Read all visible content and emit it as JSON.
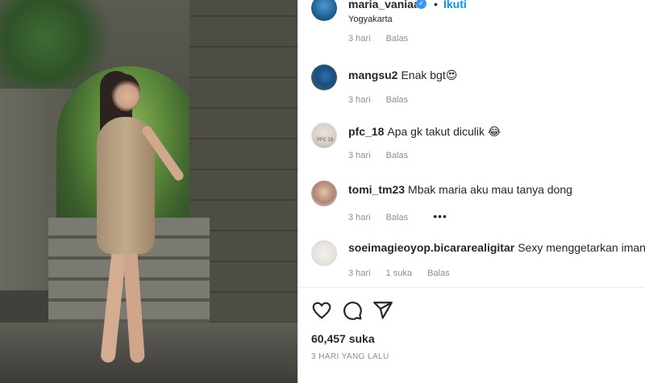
{
  "post": {
    "username": "maria_vaniaa",
    "separator": "•",
    "follow_label": "Ikuti",
    "location": "Yogyakarta",
    "verified_icon": "verified-badge-icon"
  },
  "comments": [
    {
      "username": "",
      "text": "",
      "time": "3 hari",
      "reply": "Balas",
      "likes": ""
    },
    {
      "username": "mangsu2",
      "text": "Enak bgt😍",
      "time": "3 hari",
      "reply": "Balas",
      "likes": ""
    },
    {
      "username": "pfc_18",
      "text": "Apa gk takut diculik 😂",
      "time": "3 hari",
      "reply": "Balas",
      "likes": "",
      "avatar_text": "PFC 18"
    },
    {
      "username": "tomi_tm23",
      "text": "Mbak maria aku mau tanya dong",
      "time": "3 hari",
      "reply": "Balas",
      "likes": "",
      "more": "•••"
    },
    {
      "username": "soeimagieoyop.bicararealigitar",
      "text": "Sexy menggetarkan iman",
      "time": "3 hari",
      "reply": "Balas",
      "likes": "1 suka"
    }
  ],
  "actions": {
    "like_icon": "heart-icon",
    "comment_icon": "comment-icon",
    "share_icon": "share-icon"
  },
  "likes_count": "60,457 suka",
  "timestamp": "3 HARI YANG LALU",
  "colors": {
    "accent": "#0095f6",
    "verified": "#3897f0",
    "text": "#262626",
    "muted": "#8e8e8e"
  }
}
